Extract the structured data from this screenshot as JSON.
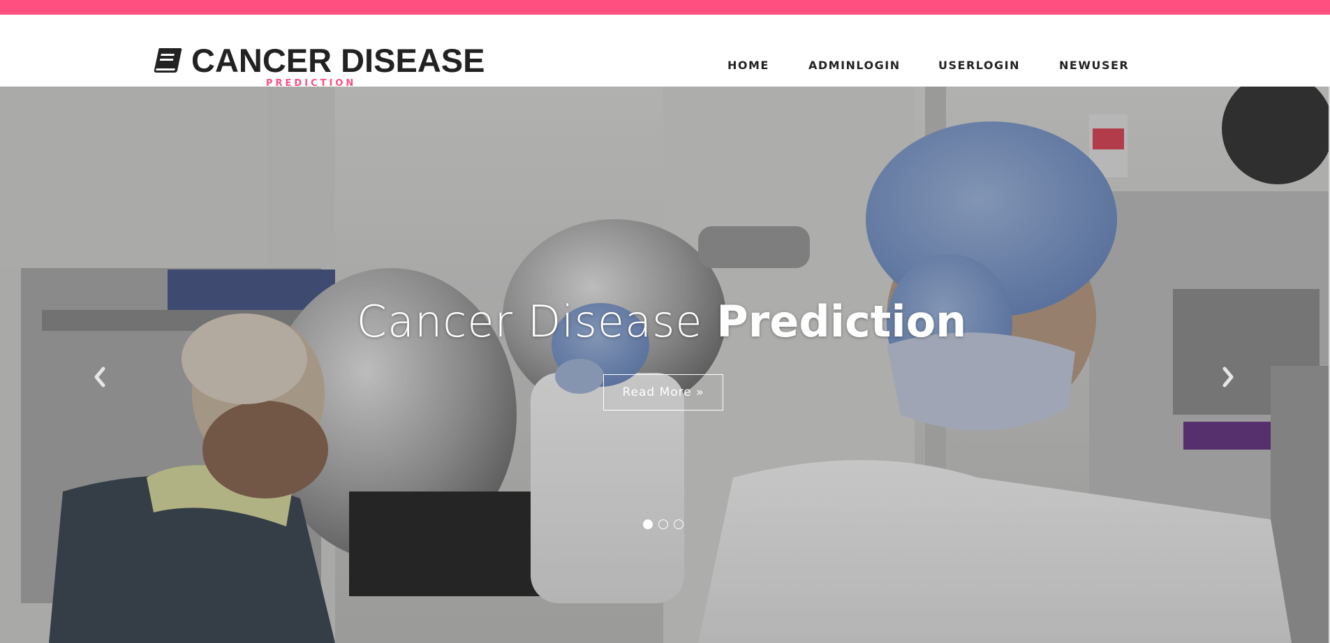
{
  "brand": {
    "title": "CANCER DISEASE",
    "subtitle": "PREDICTION",
    "icon": "book-icon",
    "accent_color": "#ff4f81"
  },
  "nav": {
    "items": [
      {
        "label": "HOME"
      },
      {
        "label": "ADMINLOGIN"
      },
      {
        "label": "USERLOGIN"
      },
      {
        "label": "NEWUSER"
      }
    ]
  },
  "hero": {
    "caption_light": "Cancer Disease",
    "caption_bold": "Prediction",
    "button_label": "Read More »",
    "prev_icon": "chevron-left-icon",
    "next_icon": "chevron-right-icon",
    "slide_count": 3,
    "active_slide": 1
  }
}
